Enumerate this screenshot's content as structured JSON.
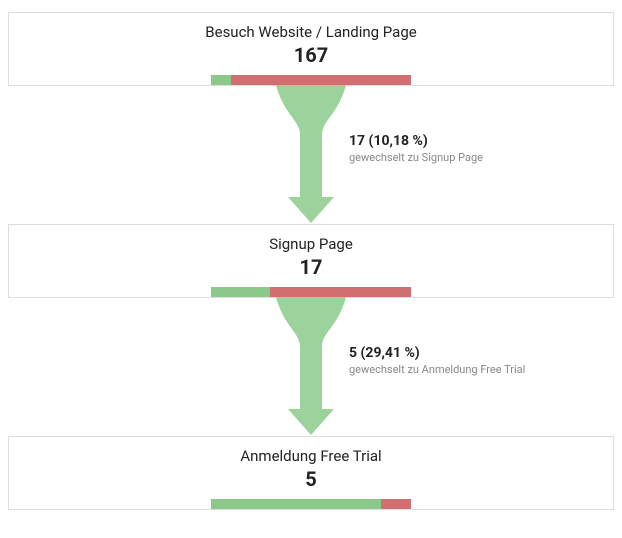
{
  "chart_data": {
    "type": "bar",
    "title": "",
    "stages": [
      {
        "label": "Besuch Website / Landing Page",
        "value": 167,
        "green_pct": 10.18,
        "red_pct": 89.82
      },
      {
        "label": "Signup Page",
        "value": 17,
        "green_pct": 29.41,
        "red_pct": 70.59
      },
      {
        "label": "Anmeldung Free Trial",
        "value": 5,
        "green_pct": 85,
        "red_pct": 15
      }
    ],
    "transitions": [
      {
        "count_pct": "17 (10,18 %)",
        "sub": "gewechselt zu Signup Page"
      },
      {
        "count_pct": "5 (29,41 %)",
        "sub": "gewechselt zu Anmeldung Free Trial"
      }
    ]
  }
}
